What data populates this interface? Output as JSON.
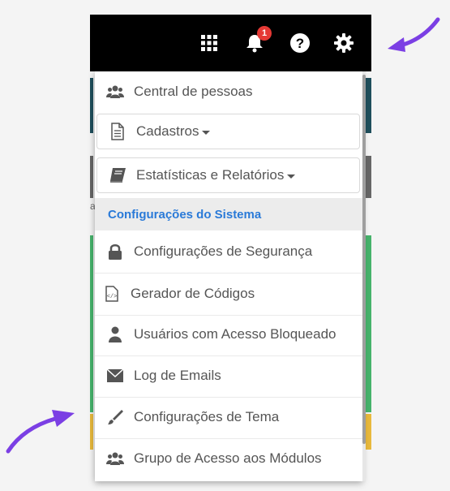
{
  "topbar": {
    "notification_count": "1",
    "icons": [
      "apps-grid-icon",
      "bell-icon",
      "help-icon",
      "gear-icon"
    ]
  },
  "menu": {
    "items": [
      {
        "label": "Central de pessoas",
        "icon": "users-icon"
      },
      {
        "label": "Cadastros",
        "icon": "document-icon"
      },
      {
        "label": "Estatísticas e Relatórios",
        "icon": "book-icon"
      }
    ],
    "section_title": "Configurações do Sistema",
    "section_items": [
      {
        "label": "Configurações de Segurança",
        "icon": "lock-icon"
      },
      {
        "label": "Gerador de Códigos",
        "icon": "code-file-icon"
      },
      {
        "label": "Usuários com Acesso Bloqueado",
        "icon": "user-icon"
      },
      {
        "label": "Log de Emails",
        "icon": "envelope-icon"
      },
      {
        "label": "Configurações de Tema",
        "icon": "brush-icon"
      },
      {
        "label": "Grupo de Acesso aos Módulos",
        "icon": "users-icon"
      }
    ]
  },
  "background": {
    "partial_text": "a"
  },
  "colors": {
    "accent": "#2a7ad8",
    "annotation_arrow": "#7b3fe4",
    "badge": "#e53935",
    "strip_teal": "#1f4f5c",
    "strip_gray": "#666666",
    "strip_green": "#46b36b",
    "strip_yellow": "#e8b93c"
  }
}
